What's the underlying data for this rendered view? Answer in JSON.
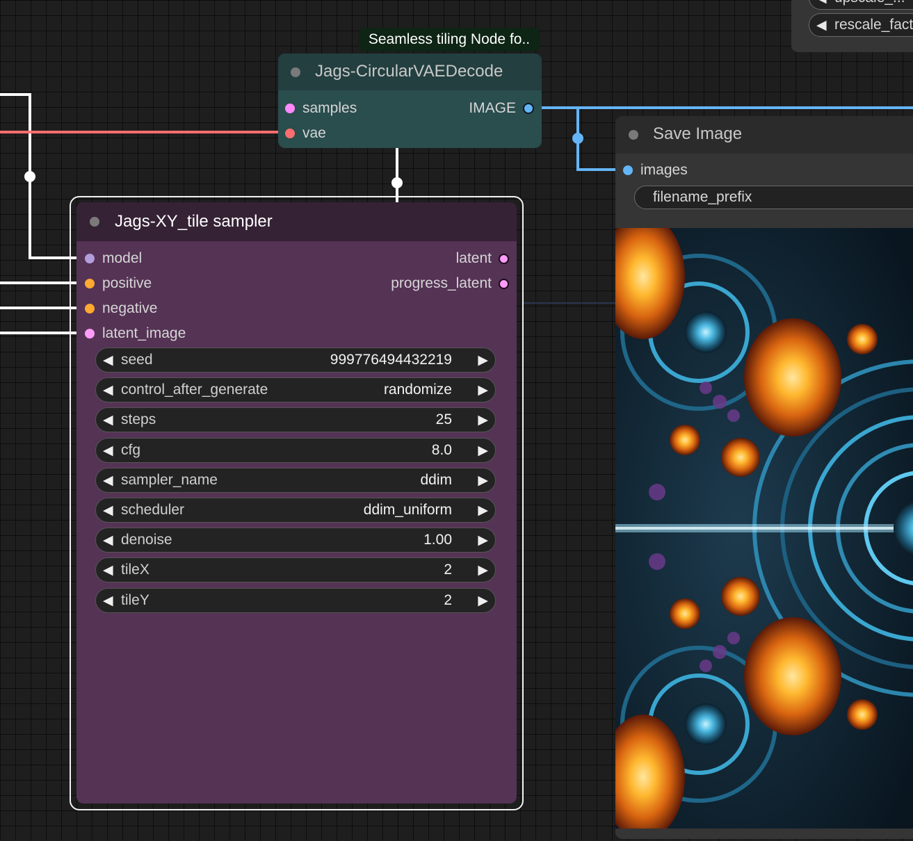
{
  "top_right_node": {
    "widgets": [
      {
        "label": "upscale_...",
        "partial": true
      },
      {
        "label": "rescale_factor"
      }
    ]
  },
  "vae_decode_node": {
    "badge": "Seamless tiling Node fo..",
    "title": "Jags-CircularVAEDecode",
    "inputs": [
      {
        "label": "samples",
        "color": "#ff88ff"
      },
      {
        "label": "vae",
        "color": "#ff6e6e"
      }
    ],
    "outputs": [
      {
        "label": "IMAGE",
        "color": "#64b5f6"
      }
    ]
  },
  "sampler_node": {
    "title": "Jags-XY_tile sampler",
    "inputs": [
      {
        "label": "model",
        "color": "#b39ddb"
      },
      {
        "label": "positive",
        "color": "#ffa931"
      },
      {
        "label": "negative",
        "color": "#ffa931"
      },
      {
        "label": "latent_image",
        "color": "#ff9cf9"
      }
    ],
    "outputs": [
      {
        "label": "latent",
        "color": "#ff9cf9"
      },
      {
        "label": "progress_latent",
        "color": "#ff9cf9"
      }
    ],
    "widgets": [
      {
        "label": "seed",
        "value": "999776494432219"
      },
      {
        "label": "control_after_generate",
        "value": "randomize"
      },
      {
        "label": "steps",
        "value": "25"
      },
      {
        "label": "cfg",
        "value": "8.0"
      },
      {
        "label": "sampler_name",
        "value": "ddim"
      },
      {
        "label": "scheduler",
        "value": "ddim_uniform"
      },
      {
        "label": "denoise",
        "value": "1.00"
      },
      {
        "label": "tileX",
        "value": "2"
      },
      {
        "label": "tileY",
        "value": "2"
      }
    ]
  },
  "save_image_node": {
    "title": "Save Image",
    "inputs": [
      {
        "label": "images",
        "color": "#64b5f6"
      }
    ],
    "widgets": [
      {
        "label": "filename_prefix"
      }
    ]
  },
  "colors": {
    "canvas": "#1e1e1e",
    "model_link": "#ffffff",
    "vae_link": "#ff6e6e",
    "image_link": "#64b5f6",
    "latent_link": "#ffffff"
  },
  "icons": {
    "decrement": "triangle-left-icon",
    "increment": "triangle-right-icon",
    "collapse": "circle-dot-icon"
  }
}
